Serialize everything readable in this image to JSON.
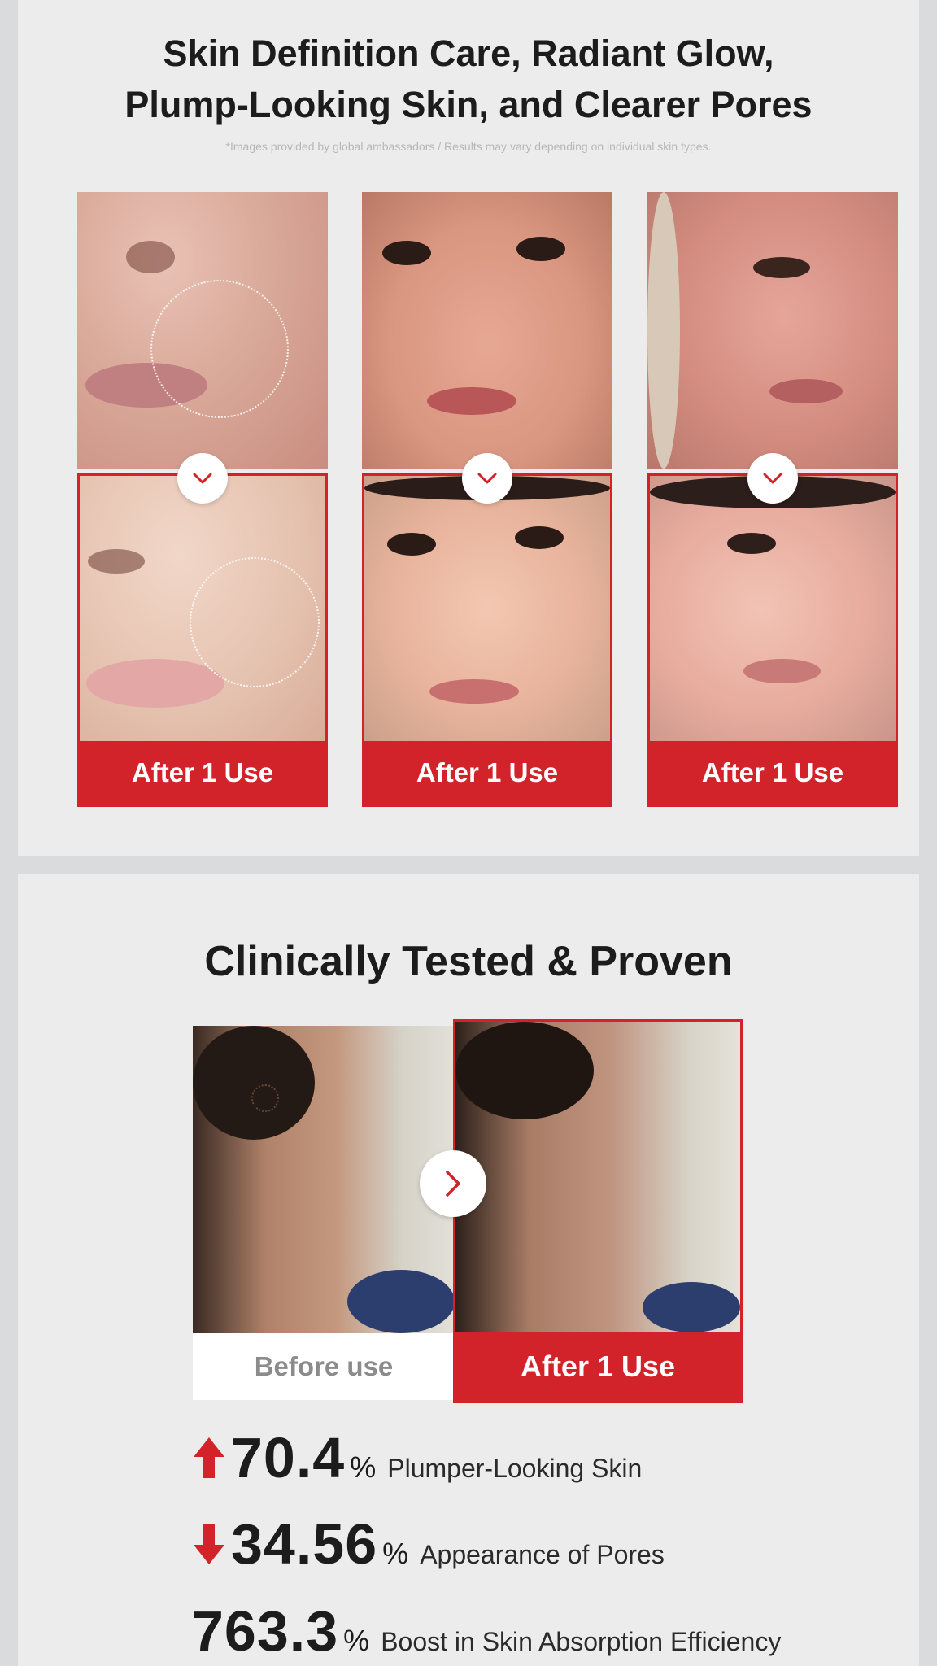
{
  "section_results": {
    "headline_line1": "Skin Definition Care, Radiant Glow,",
    "headline_line2": "Plump-Looking Skin, and Clearer Pores",
    "disclaimer": "*Images provided by global ambassadors / Results may vary depending on individual skin types.",
    "columns": [
      {
        "after_label": "After 1 Use"
      },
      {
        "after_label": "After 1 Use"
      },
      {
        "after_label": "After 1 Use"
      }
    ]
  },
  "section_clinical": {
    "headline": "Clinically Tested & Proven",
    "before_label": "Before use",
    "after_label": "After 1 Use",
    "stats": [
      {
        "value": "70.4",
        "unit": "%",
        "label": "Plumper-Looking Skin",
        "direction": "up"
      },
      {
        "value": "34.56",
        "unit": "%",
        "label": "Appearance of Pores",
        "direction": "down"
      },
      {
        "value": "763.3",
        "unit": "%",
        "label": "Boost in Skin Absorption Efficiency",
        "direction": "none"
      }
    ]
  },
  "colors": {
    "accent_red": "#d3232a",
    "panel_bg": "#ececed",
    "page_bg": "#d9dbdd"
  },
  "icons": {
    "chevron": "chevron-down-icon",
    "next": "chevron-right-icon",
    "up_arrow": "arrow-up-icon",
    "down_arrow": "arrow-down-icon"
  }
}
